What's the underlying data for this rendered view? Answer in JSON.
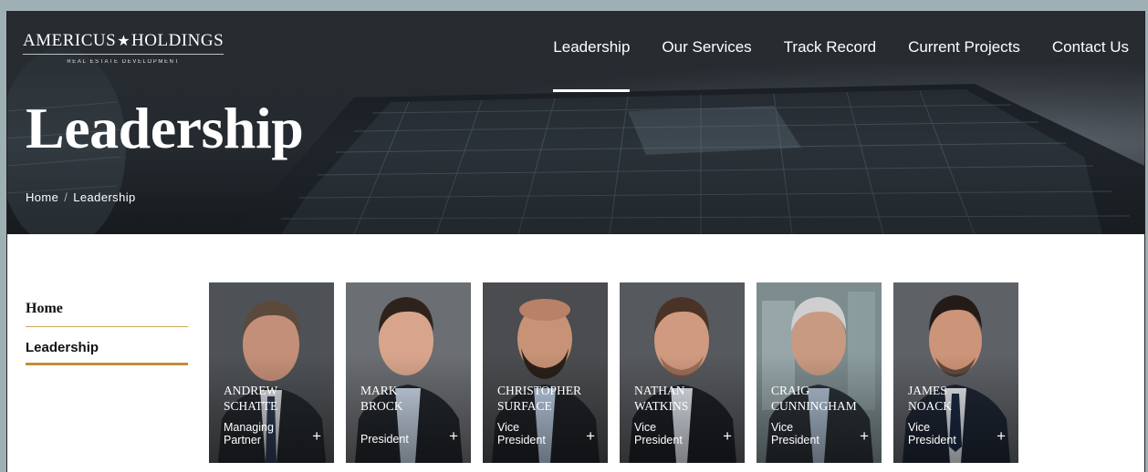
{
  "brand": {
    "name_left": "AMERICUS",
    "name_right": "HOLDINGS",
    "tagline": "REAL ESTATE DEVELOPMENT",
    "star_icon": "star-icon"
  },
  "nav": {
    "items": [
      {
        "label": "Leadership",
        "active": true
      },
      {
        "label": "Our Services",
        "active": false
      },
      {
        "label": "Track Record",
        "active": false
      },
      {
        "label": "Current Projects",
        "active": false
      },
      {
        "label": "Contact Us",
        "active": false
      }
    ]
  },
  "hero": {
    "title": "Leadership",
    "breadcrumb": {
      "home": "Home",
      "separator": "/",
      "current": "Leadership"
    }
  },
  "sidebar": {
    "items": [
      {
        "label": "Home"
      },
      {
        "label": "Leadership"
      }
    ]
  },
  "team": [
    {
      "name_line1": "ANDREW",
      "name_line2": "SCHATTE",
      "role_line1": "Managing",
      "role_line2": "Partner"
    },
    {
      "name_line1": "MARK",
      "name_line2": "BROCK",
      "role_line1": "President",
      "role_line2": ""
    },
    {
      "name_line1": "CHRISTOPHER",
      "name_line2": "SURFACE",
      "role_line1": "Vice",
      "role_line2": "President"
    },
    {
      "name_line1": "NATHAN",
      "name_line2": "WATKINS",
      "role_line1": "Vice",
      "role_line2": "President"
    },
    {
      "name_line1": "CRAIG",
      "name_line2": "CUNNINGHAM",
      "role_line1": "Vice",
      "role_line2": "President"
    },
    {
      "name_line1": "JAMES",
      "name_line2": "NOACK",
      "role_line1": "Vice",
      "role_line2": "President"
    }
  ],
  "card_action_glyph": "+",
  "colors": {
    "accent_gold": "#c08f3a",
    "accent_gold_light": "#c9a65a",
    "hero_dark": "#2a3036"
  }
}
